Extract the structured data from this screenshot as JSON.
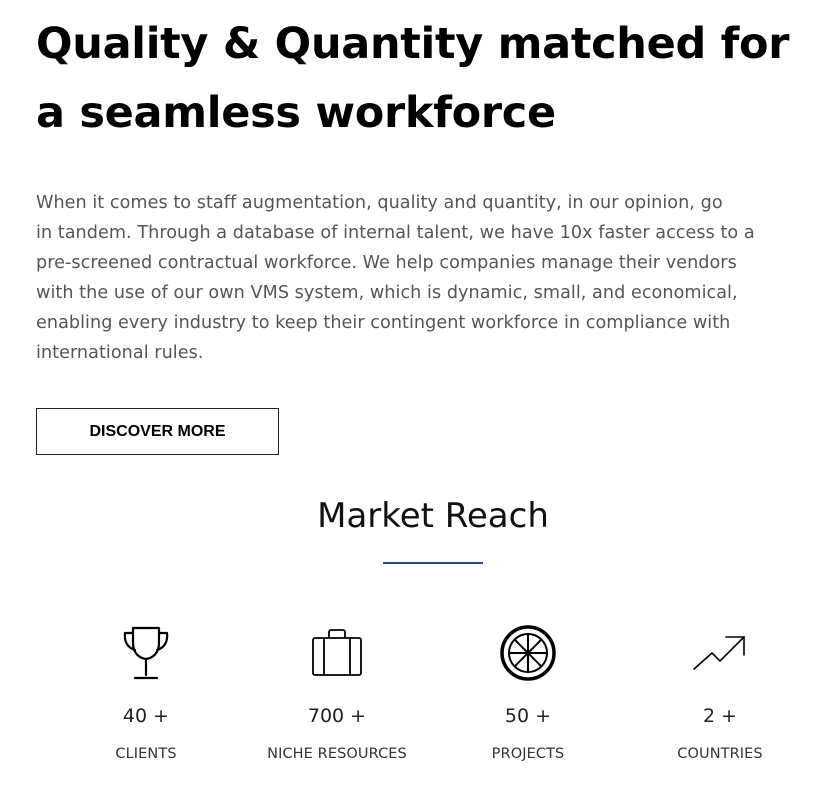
{
  "hero": {
    "title_line1": "Quality & Quantity matched for",
    "title_line2": "a seamless workforce",
    "paragraph_lines": [
      "When it comes to staff augmentation, quality and quantity, in our opinion, go",
      "in tandem. Through a database of internal talent, we have 10x faster access to a",
      "pre-screened contractual workforce. We help companies manage their vendors",
      "with the use of our own VMS system, which is dynamic, small, and economical,",
      "enabling every industry to keep their contingent workforce in compliance with",
      "international rules."
    ],
    "button_label": "DISCOVER MORE"
  },
  "market_reach": {
    "title": "Market Reach",
    "accent_color": "#1f4e8c",
    "stats": [
      {
        "icon": "trophy-icon",
        "value": "40 +",
        "label": "CLIENTS"
      },
      {
        "icon": "briefcase-icon",
        "value": "700 +",
        "label": "NICHE RESOURCES"
      },
      {
        "icon": "wheel-icon",
        "value": "50 +",
        "label": "PROJECTS"
      },
      {
        "icon": "trending-up-icon",
        "value": "2 +",
        "label": "COUNTRIES"
      }
    ]
  }
}
